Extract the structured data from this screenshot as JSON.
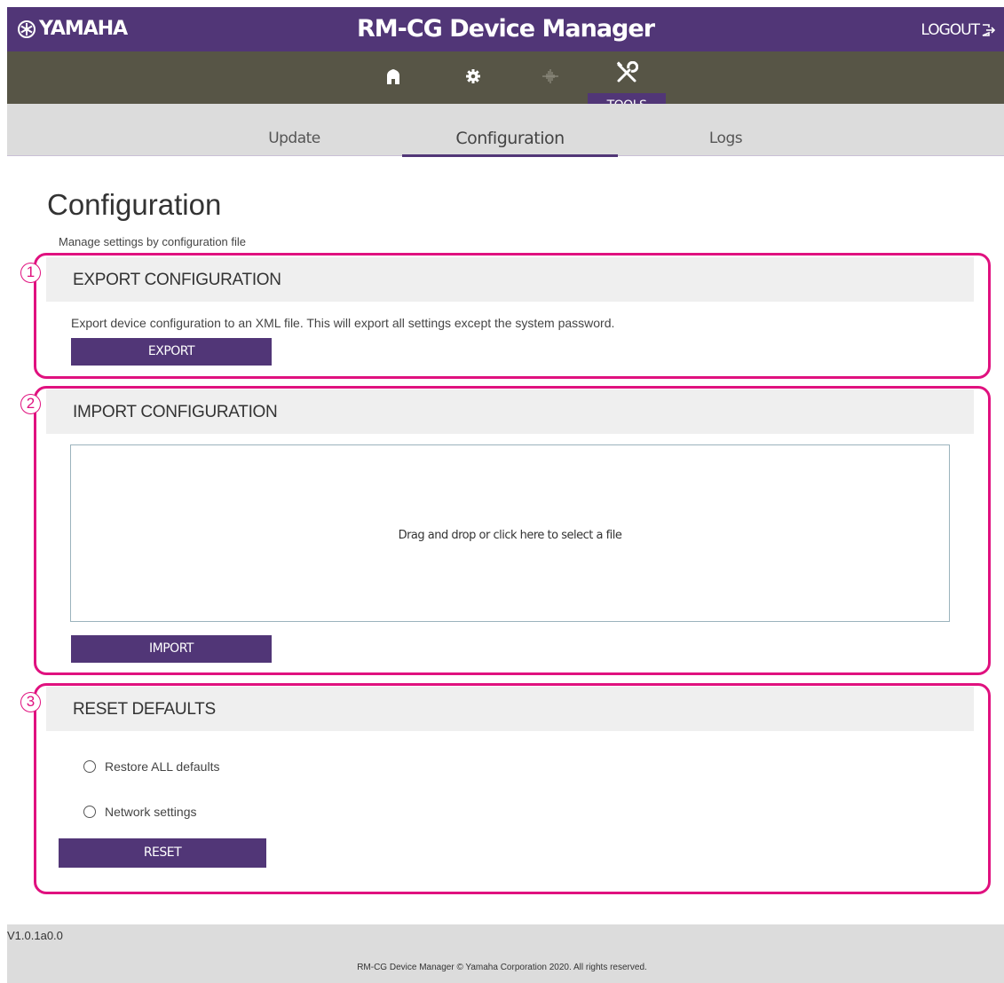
{
  "header": {
    "logo_text": "YAMAHA",
    "app_title": "RM-CG Device Manager",
    "logout_label": "LOGOUT"
  },
  "nav": {
    "icons": [
      "home-icon",
      "gear-icon",
      "audio-wave-icon",
      "tools-icon"
    ],
    "active_label": "TOOLS"
  },
  "subnav": {
    "tabs": [
      {
        "label": "Update"
      },
      {
        "label": "Configuration"
      },
      {
        "label": "Logs"
      }
    ],
    "active_index": 1
  },
  "page": {
    "title": "Configuration",
    "subtitle": "Manage settings by configuration file"
  },
  "sections": {
    "export": {
      "number": "1",
      "title": "EXPORT CONFIGURATION",
      "description": "Export device configuration to an XML file. This will export all settings except the system password.",
      "button": "EXPORT"
    },
    "import": {
      "number": "2",
      "title": "IMPORT CONFIGURATION",
      "dropzone_text": "Drag and drop or click here to select a file",
      "button": "IMPORT"
    },
    "reset": {
      "number": "3",
      "title": "RESET DEFAULTS",
      "options": [
        "Restore ALL defaults",
        "Network settings"
      ],
      "button": "RESET"
    }
  },
  "footer": {
    "version": "V1.0.1a0.0",
    "copyright": "RM-CG Device Manager © Yamaha Corporation 2020. All rights reserved."
  },
  "colors": {
    "brand_purple": "#513677",
    "nav_gray": "#575546",
    "annotation_pink": "#e0117f"
  }
}
